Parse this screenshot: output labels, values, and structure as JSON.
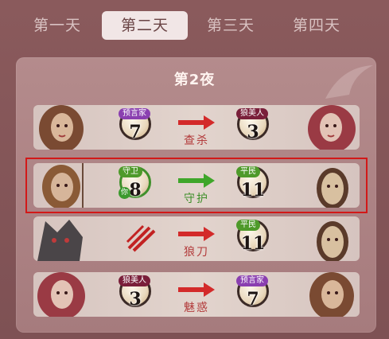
{
  "tabs": [
    "第一天",
    "第二天",
    "第三天",
    "第四天"
  ],
  "active_tab": 1,
  "panel_title": "第2夜",
  "actions": [
    {
      "left_role": "预言家",
      "left_num": "7",
      "action": "查杀",
      "right_role": "狼美人",
      "right_num": "3",
      "arrow": "red"
    },
    {
      "left_role": "守卫",
      "left_num": "8",
      "left_you": "你",
      "action": "守护",
      "right_role": "平民",
      "right_num": "11",
      "arrow": "green"
    },
    {
      "left_role": "",
      "left_num": "",
      "action": "狼刀",
      "right_role": "平民",
      "right_num": "11",
      "arrow": "red"
    },
    {
      "left_role": "狼美人",
      "left_num": "3",
      "action": "魅惑",
      "right_role": "预言家",
      "right_num": "7",
      "arrow": "red"
    }
  ],
  "colors": {
    "active_tab_bg": "#f1e6e6",
    "highlight": "#d21818",
    "kill_arrow": "#d32a2a",
    "guard_arrow": "#3fa62a"
  }
}
